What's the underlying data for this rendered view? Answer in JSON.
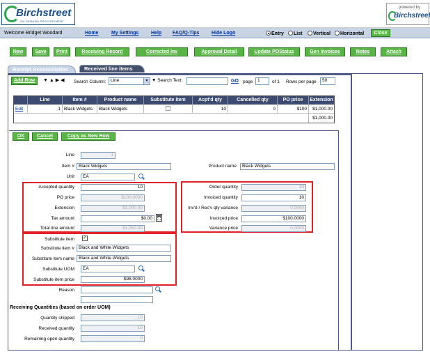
{
  "header": {
    "brand": "Birchstreet",
    "tagline": "ON DEMAND PROCUREMENT",
    "powered_by": "powered by",
    "powered_brand": "Birchstreet"
  },
  "nav": {
    "welcome": "Welcome Bridget Woodard",
    "links": [
      "Home",
      "My Settings",
      "Help",
      "FAQ/Q-Tips",
      "Hide Logo"
    ],
    "view_modes": [
      "Entry",
      "List",
      "Vertical",
      "Horizontal"
    ],
    "selected_view": "Entry",
    "close_label": "Close"
  },
  "toolbar": {
    "buttons": [
      "New",
      "Save",
      "Print",
      "Receiving Record",
      "Corrected Inv",
      "Approval Detail",
      "Update POStatus",
      "Gen Invoices",
      "Notes",
      "Attach"
    ]
  },
  "tabs": {
    "tab1": "Receipt Reconciliation",
    "tab2": "Received line items"
  },
  "gridbar": {
    "add_row": "Add Row",
    "search_column_label": "Search Column:",
    "search_column_value": "Line",
    "search_text_label": "Search Text:",
    "search_text_value": "",
    "go": "GO",
    "page_label": "page",
    "page_value": "1",
    "of_label": "of 1",
    "rows_label": "Rows per page",
    "rows_value": "50"
  },
  "grid": {
    "columns": [
      "Line",
      "Item #",
      "Product name",
      "Substitute item",
      "Acpt'd qty",
      "Cancelled qty",
      "PO price",
      "Extension"
    ],
    "rows": [
      {
        "edit": "Edit",
        "line": "1",
        "item": "Black Widgets",
        "product": "Black Widgets",
        "acpt": "10",
        "cancelled": "0",
        "po_price": "$100",
        "extension": "$1,000.00"
      }
    ],
    "total": "$1,000.00"
  },
  "form": {
    "buttons": {
      "ok": "OK",
      "cancel": "Cancel",
      "copy": "Copy as New Row"
    },
    "line_label": "Line",
    "line_value": "1",
    "item_label": "Item #",
    "item_value": "Black Widgets",
    "product_label": "Product name",
    "product_value": "Black Widgets",
    "unit_label": "Unit",
    "unit_value": "EA",
    "accepted_qty_label": "Accepted quantity",
    "accepted_qty_value": "10",
    "po_price_label": "PO price",
    "po_price_value": "$100.0000",
    "extension_label": "Extension",
    "extension_value": "$1,000.00",
    "tax_label": "Tax amount",
    "tax_value": "$0.00",
    "total_line_label": "Total line amount",
    "total_line_value": "$1,050.00",
    "order_qty_label": "Order quantity",
    "order_qty_value": "10",
    "invoiced_qty_label": "Invoiced quantity",
    "invoiced_qty_value": "10",
    "variance_label": "Inv'd / Rec'v qty variance",
    "variance_value": "0.0000",
    "invoiced_price_label": "Invoiced price",
    "invoiced_price_value": "$100.0000",
    "variance_price_label": "Variance price",
    "variance_price_value": "0.0000",
    "sub_item_label": "Substitute item",
    "sub_item_num_label": "Substitute item #",
    "sub_item_num_value": "Black and White Widgets",
    "sub_item_name_label": "Substitute item name",
    "sub_item_name_value": "Black and White Widgets",
    "sub_uom_label": "Substitute UOM",
    "sub_uom_value": "EA",
    "sub_price_label": "Substitute item price",
    "sub_price_value": "$98.0000",
    "reason_label": "Reason",
    "reason_value": "",
    "receiving_heading": "Receiving Quantities (based on order UOM)",
    "qty_shipped_label": "Quantity shipped",
    "qty_shipped_value": "10",
    "received_qty_label": "Received quantity",
    "received_qty_value": "10",
    "remaining_label": "Remaining open quantity",
    "remaining_value": "0"
  }
}
